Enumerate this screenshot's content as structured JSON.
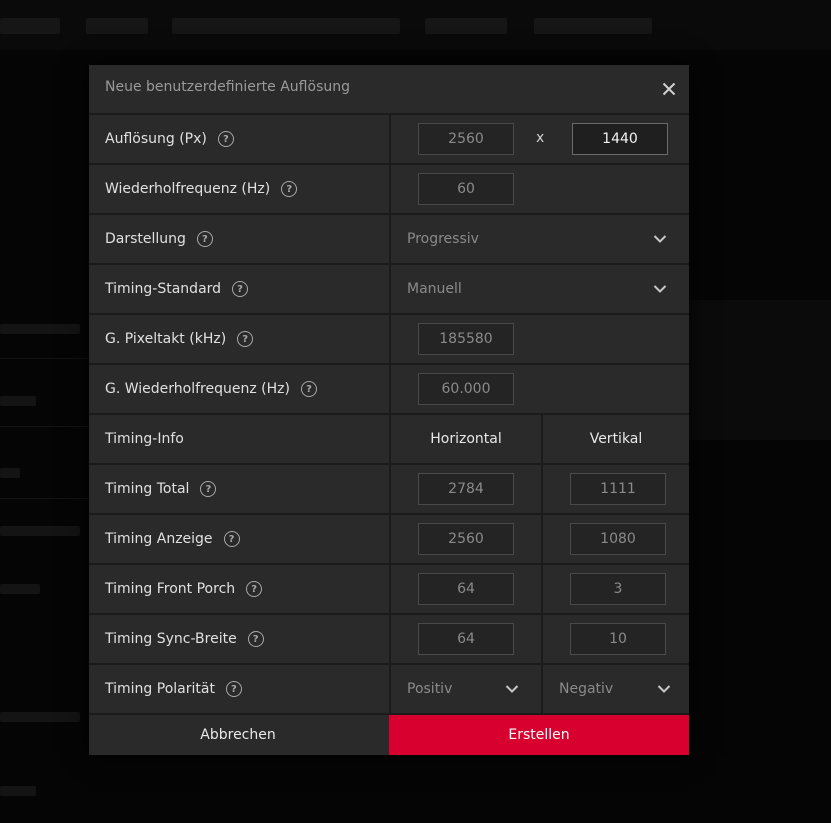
{
  "dialog": {
    "title": "Neue benutzerdefinierte Auflösung",
    "close_icon": "close-icon"
  },
  "rows": {
    "resolution": {
      "label": "Auflösung (Px)",
      "width": "2560",
      "separator": "x",
      "height": "1440"
    },
    "refresh": {
      "label": "Wiederholfrequenz (Hz)",
      "value": "60"
    },
    "display": {
      "label": "Darstellung",
      "value": "Progressiv"
    },
    "timing_standard": {
      "label": "Timing-Standard",
      "value": "Manuell"
    },
    "pixel_clock": {
      "label": "G. Pixeltakt (kHz)",
      "value": "185580"
    },
    "g_refresh": {
      "label": "G. Wiederholfrequenz (Hz)",
      "value": "60.000"
    },
    "timing_info": {
      "label": "Timing-Info",
      "horizontal": "Horizontal",
      "vertical": "Vertikal"
    },
    "timing_total": {
      "label": "Timing Total",
      "h": "2784",
      "v": "1111"
    },
    "timing_display": {
      "label": "Timing Anzeige",
      "h": "2560",
      "v": "1080"
    },
    "front_porch": {
      "label": "Timing Front Porch",
      "h": "64",
      "v": "3"
    },
    "sync_width": {
      "label": "Timing Sync-Breite",
      "h": "64",
      "v": "10"
    },
    "polarity": {
      "label": "Timing Polarität",
      "h": "Positiv",
      "v": "Negativ"
    }
  },
  "footer": {
    "cancel_label": "Abbrechen",
    "create_label": "Erstellen"
  },
  "colors": {
    "accent": "#d8002f",
    "dialog_bg": "#2a2a2a",
    "divider": "#1b1b1b"
  }
}
